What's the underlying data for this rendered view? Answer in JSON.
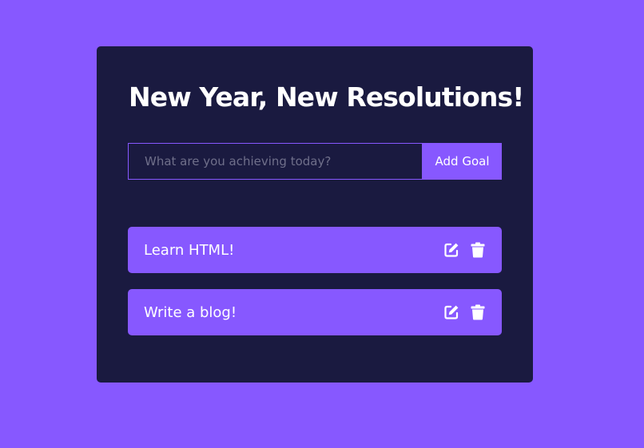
{
  "app": {
    "title": "New Year, New Resolutions!"
  },
  "form": {
    "placeholder": "What are you achieving today?",
    "value": "",
    "add_label": "Add Goal"
  },
  "goals": [
    {
      "text": "Learn HTML!",
      "edit_icon": "edit-icon",
      "delete_icon": "trash-icon"
    },
    {
      "text": "Write a blog!",
      "edit_icon": "edit-icon",
      "delete_icon": "trash-icon"
    }
  ],
  "colors": {
    "background": "#8758ff",
    "card": "#1a1a40",
    "accent": "#8758ff",
    "text": "#ffffff",
    "placeholder": "#6f6f8a"
  }
}
